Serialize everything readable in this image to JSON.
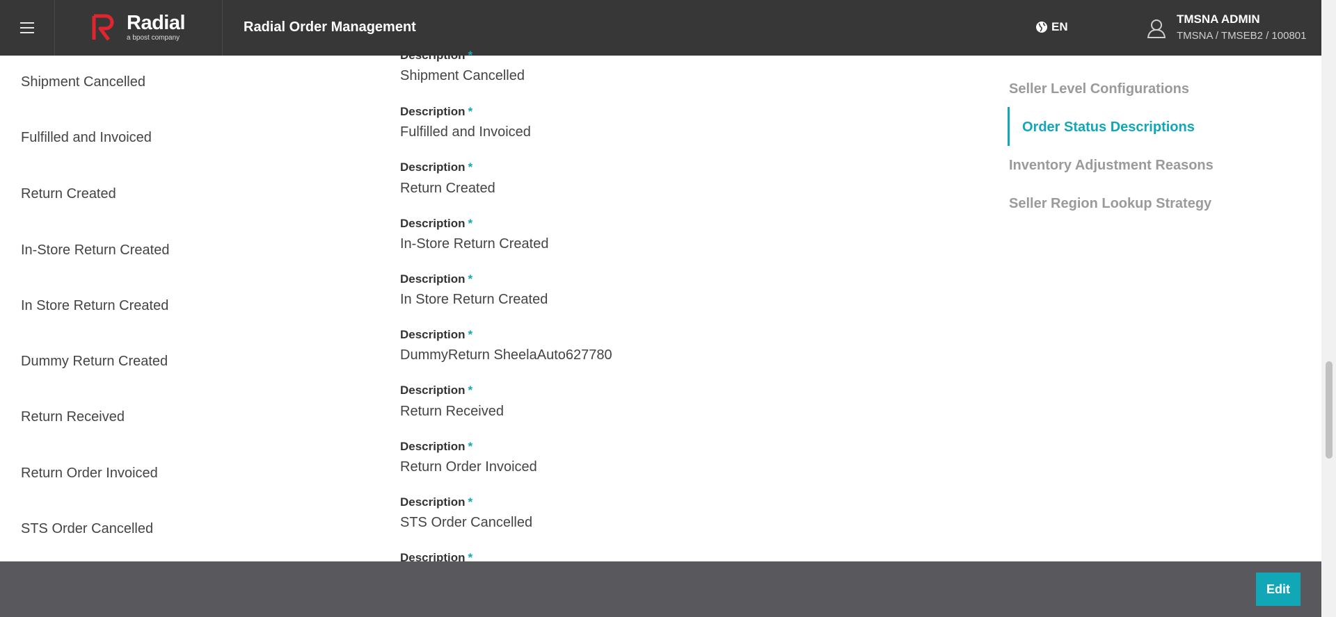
{
  "header": {
    "logo_text": "Radial",
    "logo_sub": "a bpost company",
    "app_title": "Radial Order Management",
    "language": "EN",
    "user_name": "TMSNA ADMIN",
    "user_path": "TMSNA / TMSEB2 / 100801"
  },
  "left_list": [
    "Shipment Cancelled",
    "Fulfilled and Invoiced",
    "Return Created",
    "In-Store Return Created",
    "In Store Return Created",
    "Dummy Return Created",
    "Return Received",
    "Return Order Invoiced",
    "STS Order Cancelled"
  ],
  "descriptions": {
    "label": "Description",
    "required_mark": "*",
    "values": [
      "Shipment Cancelled",
      "Fulfilled and Invoiced",
      "Return Created",
      "In-Store Return Created",
      "In Store Return Created",
      "DummyReturn SheelaAuto627780",
      "Return Received",
      "Return Order Invoiced",
      "STS Order Cancelled"
    ]
  },
  "side_nav": [
    "Seller Level Configurations",
    "Order Status Descriptions",
    "Inventory Adjustment Reasons",
    "Seller Region Lookup Strategy"
  ],
  "footer": {
    "edit_label": "Edit"
  },
  "colors": {
    "accent": "#12a7b6",
    "header_bg": "#373737",
    "footer_bg": "#58585d",
    "logo_red": "#e1252f"
  },
  "icons": [
    "menu-icon",
    "radial-logo-icon",
    "globe-icon",
    "user-icon"
  ]
}
